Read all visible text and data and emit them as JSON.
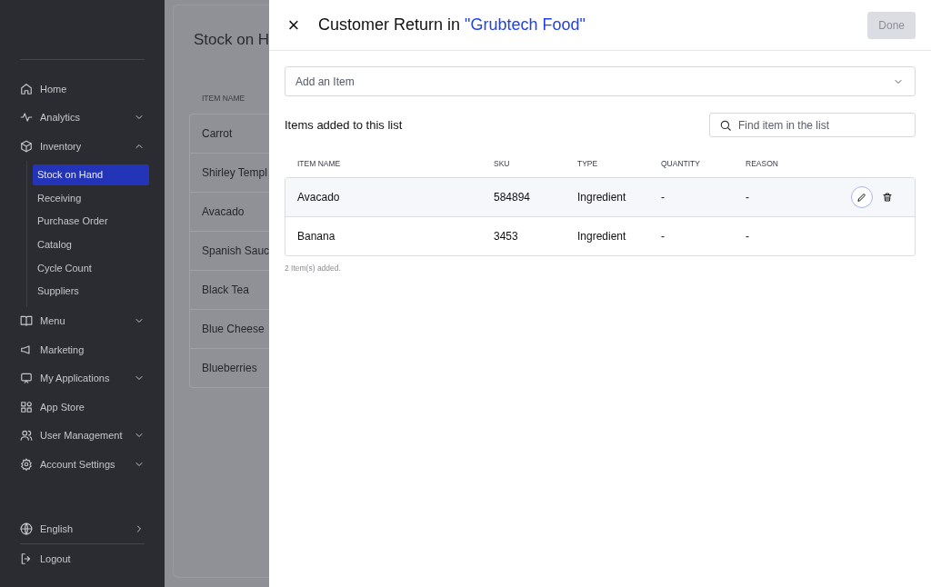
{
  "sidebar": {
    "items": [
      {
        "label": "Home",
        "kind": "link"
      },
      {
        "label": "Analytics",
        "kind": "group",
        "expanded": false
      },
      {
        "label": "Inventory",
        "kind": "group",
        "expanded": true,
        "children": [
          {
            "label": "Stock on Hand",
            "selected": true
          },
          {
            "label": "Receiving",
            "selected": false
          },
          {
            "label": "Purchase Order",
            "selected": false
          },
          {
            "label": "Catalog",
            "selected": false
          },
          {
            "label": "Cycle Count",
            "selected": false
          },
          {
            "label": "Suppliers",
            "selected": false
          }
        ]
      },
      {
        "label": "Menu",
        "kind": "group",
        "expanded": false
      },
      {
        "label": "Marketing",
        "kind": "link"
      },
      {
        "label": "My Applications",
        "kind": "group",
        "expanded": false
      },
      {
        "label": "App Store",
        "kind": "link"
      },
      {
        "label": "User Management",
        "kind": "group",
        "expanded": false
      },
      {
        "label": "Account Settings",
        "kind": "group",
        "expanded": false
      }
    ],
    "footer": [
      {
        "label": "English",
        "kind": "submenu"
      },
      {
        "label": "Logout",
        "kind": "link"
      }
    ]
  },
  "background_page": {
    "title": "Stock on H",
    "column": "ITEM NAME",
    "rows": [
      "Carrot",
      "Shirley Templ",
      "Avacado",
      "Spanish Sauc",
      "Black Tea",
      "Blue Cheese",
      "Blueberries"
    ]
  },
  "drawer": {
    "close": "×",
    "title": "Customer Return in ",
    "title_link": "\"Grubtech Food\"",
    "done_button": {
      "label": "Done",
      "disabled": true
    },
    "add_item": {
      "placeholder": "Add an Item"
    },
    "section_title": "Items added to this list",
    "search": {
      "placeholder": "Find item in the list"
    },
    "table": {
      "columns": [
        "ITEM NAME",
        "SKU",
        "TYPE",
        "QUANTITY",
        "REASON"
      ],
      "rows": [
        {
          "cells": [
            "Avacado",
            "584894",
            "Ingredient",
            "-",
            "-"
          ],
          "selected": true
        },
        {
          "cells": [
            "Banana",
            "3453",
            "Ingredient",
            "-",
            "-"
          ],
          "selected": false
        }
      ]
    },
    "footnote": "2 Item(s) added."
  }
}
